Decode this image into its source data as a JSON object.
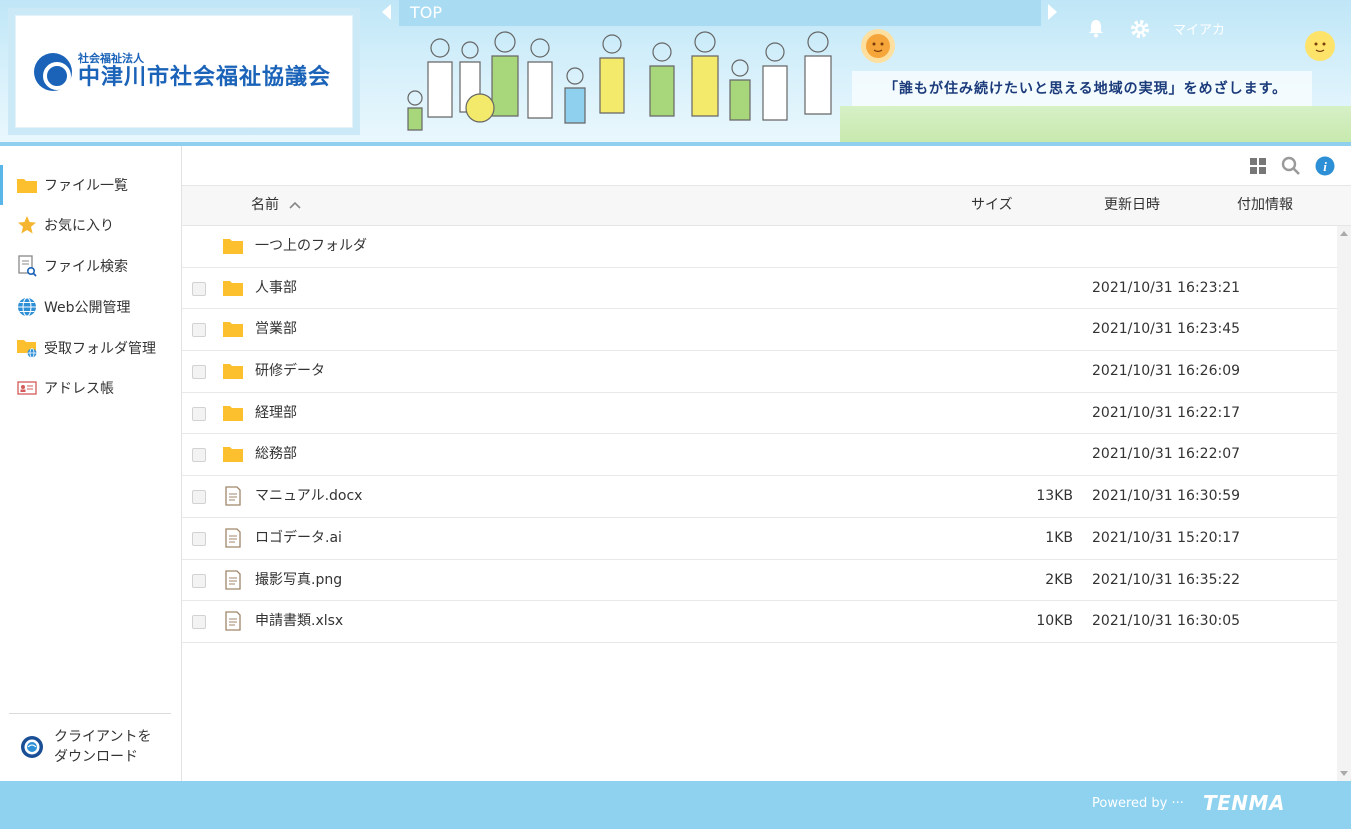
{
  "header": {
    "logo_subtitle": "社会福祉法人",
    "logo_title": "中津川市社会福祉協議会",
    "top_label": "TOP",
    "account_label": "マイアカ",
    "slogan": "「誰もが住み続けたいと思える地域の実現」をめざします。"
  },
  "sidebar": {
    "items": [
      {
        "label": "ファイル一覧",
        "icon": "folder-icon",
        "active": true
      },
      {
        "label": "お気に入り",
        "icon": "star-icon",
        "active": false
      },
      {
        "label": "ファイル検索",
        "icon": "file-search-icon",
        "active": false
      },
      {
        "label": "Web公開管理",
        "icon": "globe-icon",
        "active": false
      },
      {
        "label": "受取フォルダ管理",
        "icon": "folder-globe-icon",
        "active": false
      },
      {
        "label": "アドレス帳",
        "icon": "address-card-icon",
        "active": false
      }
    ],
    "download_line1": "クライアントを",
    "download_line2": "ダウンロード"
  },
  "table": {
    "headers": {
      "name": "名前",
      "size": "サイズ",
      "updated": "更新日時",
      "info": "付加情報"
    },
    "sort_indicator": "ascending",
    "rows": [
      {
        "name": "一つ上のフォルダ",
        "type": "folder",
        "size": "",
        "date": "",
        "checkbox": false
      },
      {
        "name": "人事部",
        "type": "folder",
        "size": "",
        "date": "2021/10/31 16:23:21",
        "checkbox": true
      },
      {
        "name": "営業部",
        "type": "folder",
        "size": "",
        "date": "2021/10/31 16:23:45",
        "checkbox": true
      },
      {
        "name": "研修データ",
        "type": "folder",
        "size": "",
        "date": "2021/10/31 16:26:09",
        "checkbox": true
      },
      {
        "name": "経理部",
        "type": "folder",
        "size": "",
        "date": "2021/10/31 16:22:17",
        "checkbox": true
      },
      {
        "name": "総務部",
        "type": "folder",
        "size": "",
        "date": "2021/10/31 16:22:07",
        "checkbox": true
      },
      {
        "name": "マニュアル.docx",
        "type": "file",
        "size": "13KB",
        "date": "2021/10/31 16:30:59",
        "checkbox": true
      },
      {
        "name": "ロゴデータ.ai",
        "type": "file",
        "size": "1KB",
        "date": "2021/10/31 15:20:17",
        "checkbox": true
      },
      {
        "name": "撮影写真.png",
        "type": "file",
        "size": "2KB",
        "date": "2021/10/31 16:35:22",
        "checkbox": true
      },
      {
        "name": "申請書類.xlsx",
        "type": "file",
        "size": "10KB",
        "date": "2021/10/31 16:30:05",
        "checkbox": true
      }
    ]
  },
  "footer": {
    "powered_by": "Powered by ···",
    "brand": "TENMA"
  },
  "colors": {
    "header_bg": "#d9f1fb",
    "footer_bg": "#8ed2f0",
    "folder": "#fcc02e",
    "accent_blue": "#1a63b8",
    "active_marker": "#5ab6e6"
  }
}
